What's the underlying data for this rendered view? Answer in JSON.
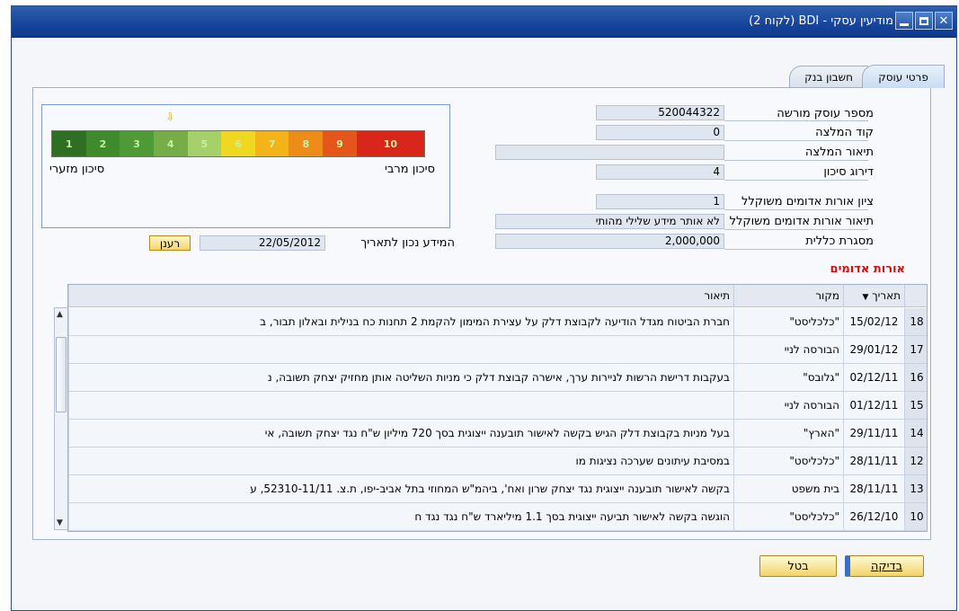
{
  "window": {
    "title": "מודיעין עסקי - BDI (לקוח 2)"
  },
  "tabs": [
    {
      "label": "פרטי עוסק",
      "active": true
    },
    {
      "label": "חשבון בנק",
      "active": false
    }
  ],
  "fields": {
    "business_id": {
      "label": "מספר עוסק מורשה",
      "value": "520044322"
    },
    "recommendation_code": {
      "label": "קוד המלצה",
      "value": "0"
    },
    "recommendation_desc": {
      "label": "תיאור המלצה",
      "value": ""
    },
    "risk_rating": {
      "label": "דירוג סיכון",
      "value": "4"
    },
    "weighted_red_lights": {
      "label": "ציון אורות אדומים משוקלל",
      "value": "1"
    },
    "weighted_red_lights_desc": {
      "label": "תיאור אורות אדומים משוקלל",
      "value": "לא אותר מידע שלילי מהותי"
    },
    "total_credit_line": {
      "label": "מסגרת כללית",
      "value": "2,000,000"
    }
  },
  "risk_scale": {
    "levels": [
      "1",
      "2",
      "3",
      "4",
      "5",
      "6",
      "7",
      "8",
      "9",
      "10"
    ],
    "colors": [
      "#2f6f24",
      "#3e8a2c",
      "#4e9a36",
      "#76ad48",
      "#a6d06a",
      "#f0d820",
      "#f2b418",
      "#ee8c1a",
      "#e5561a",
      "#d8261a"
    ],
    "current_level": 4,
    "max_label": "סיכון מרבי",
    "min_label": "סיכון מזערי",
    "arrow_icon": "down-arrow-icon"
  },
  "as_of": {
    "label": "המידע נכון לתאריך",
    "date": "22/05/2012",
    "refresh_label": "רענן"
  },
  "red_lights": {
    "title": "אורות אדומים",
    "columns": {
      "date": "תאריך",
      "source": "מקור",
      "description": "תיאור"
    },
    "rows": [
      {
        "num": "18",
        "date": "15/02/12",
        "source": "\"כלכליסט\"",
        "desc": "חברת הביטוח מגדל הודיעה לקבוצת דלק על עצירת המימון להקמת 2 תחנות כח בנילית ובאלון תבור, ב"
      },
      {
        "num": "17",
        "date": "29/01/12",
        "source": "הבורסה לניי",
        "desc": ""
      },
      {
        "num": "16",
        "date": "02/12/11",
        "source": "\"גלובס\"",
        "desc": "בעקבות דרישת הרשות לניירות ערך, אישרה קבוצת דלק כי מניות השליטה אותן מחזיק יצחק תשובה, נ"
      },
      {
        "num": "15",
        "date": "01/12/11",
        "source": "הבורסה לניי",
        "desc": ""
      },
      {
        "num": "14",
        "date": "29/11/11",
        "source": "\"הארץ\"",
        "desc": "בעל מניות בקבוצת דלק הגיש בקשה לאישור תובענה ייצוגית בסך 720 מיליון ש\"ח נגד יצחק תשובה, אי"
      },
      {
        "num": "12",
        "date": "28/11/11",
        "source": "\"כלכליסט\"",
        "desc": "במסיבת עיתונים שערכה נציגות מו"
      },
      {
        "num": "13",
        "date": "28/11/11",
        "source": "בית משפט",
        "desc": "בקשה לאישור תובענה ייצוגית נגד יצחק שרון ואח', ביהמ\"ש המחוזי בתל אביב-יפו, ת.צ. 52310-11/11, ע"
      },
      {
        "num": "10",
        "date": "26/12/10",
        "source": "\"כלכליסט\"",
        "desc": "הוגשה בקשה לאישור תביעה ייצוגית בסך 1.1 מיליארד ש\"ח נגד נגד ח"
      }
    ]
  },
  "buttons": {
    "ok": "בדיקה",
    "cancel": "בטל"
  }
}
